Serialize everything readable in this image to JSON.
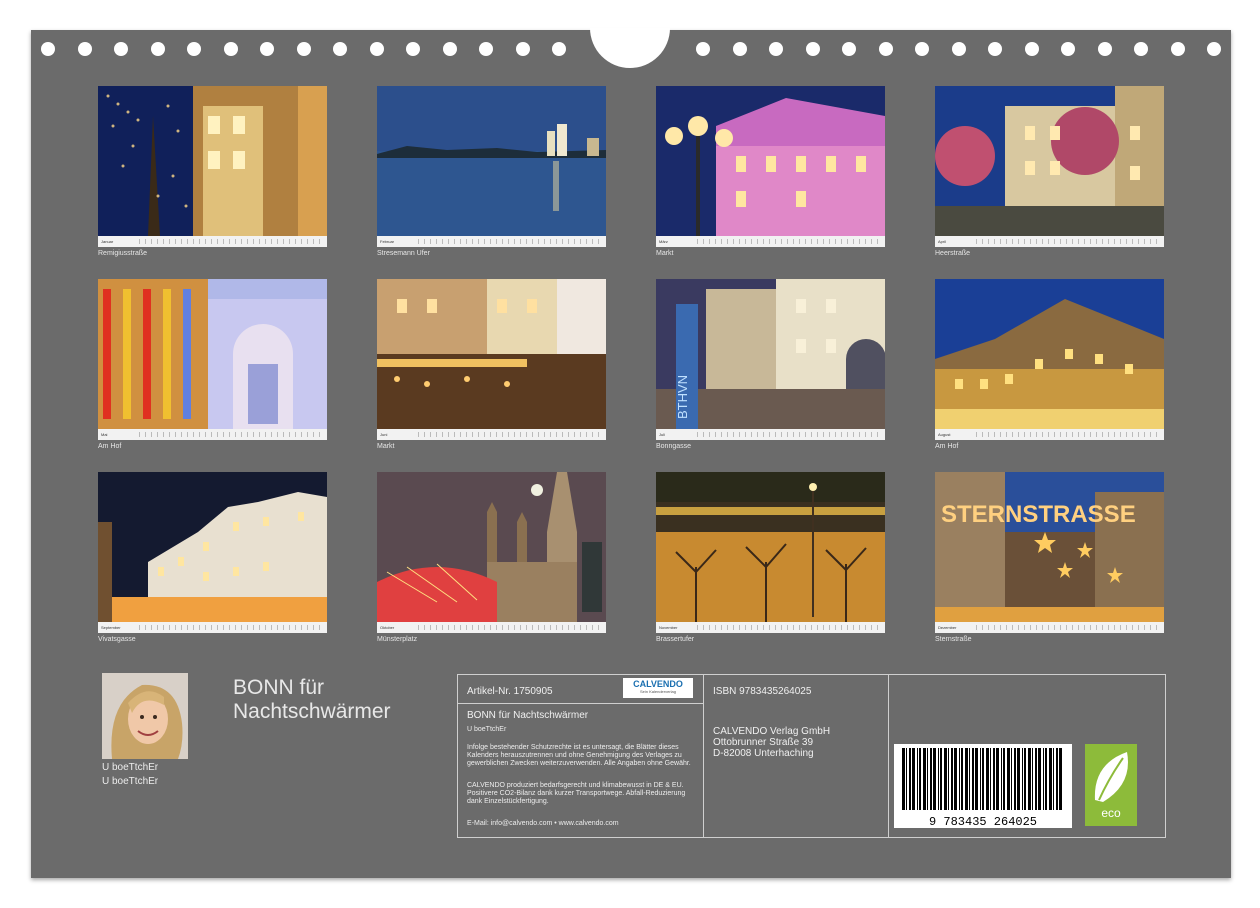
{
  "months": [
    {
      "caption": "Remigiusstraße",
      "month": "Januar"
    },
    {
      "caption": "Stresemann Ufer",
      "month": "Februar"
    },
    {
      "caption": "Markt",
      "month": "März"
    },
    {
      "caption": "Heerstraße",
      "month": "April"
    },
    {
      "caption": "Am Hof",
      "month": "Mai"
    },
    {
      "caption": "Markt",
      "month": "Juni"
    },
    {
      "caption": "Bonngasse",
      "month": "Juli"
    },
    {
      "caption": "Am Hof",
      "month": "August"
    },
    {
      "caption": "Vivatsgasse",
      "month": "September"
    },
    {
      "caption": "Münsterplatz",
      "month": "Oktober"
    },
    {
      "caption": "Brassertufer",
      "month": "November"
    },
    {
      "caption": "Sternstraße",
      "month": "Dezember"
    }
  ],
  "photo_text": {
    "sign": "STERNSTRASSE",
    "neon": "BTHVN"
  },
  "author": {
    "line1": "U boeTtchEr",
    "line2": "U boeTtchEr"
  },
  "title": {
    "line1": "BONN für",
    "line2": "Nachtschwärmer"
  },
  "info": {
    "article": "Artikel-Nr. 1750905",
    "logo": "CALVENDO",
    "logo_sub": "Sein Kalenderverlag",
    "product_title": "BONN für Nachtschwärmer",
    "product_author": "U boeTtchEr",
    "legal1": "Infolge bestehender Schutzrechte ist es untersagt, die Blätter dieses Kalenders herauszutrennen und ohne Genehmigung des Verlages zu gewerblichen Zwecken weiterzuverwenden. Alle Angaben ohne Gewähr.",
    "legal2": "CALVENDO produziert bedarfsgerecht und klimabewusst in DE & EU. Positivere CO2-Bilanz dank kurzer Transportwege. Abfall-Reduzierung dank Einzelstückfertigung.",
    "contact": "E-Mail: info@calvendo.com • www.calvendo.com",
    "isbn": "ISBN 9783435264025",
    "publisher1": "CALVENDO Verlag GmbH",
    "publisher2": "Ottobrunner Straße 39",
    "publisher3": "D-82008 Unterhaching",
    "barcode_digits": "9 783435 264025",
    "eco_label": "eco"
  },
  "colors": {
    "board": "#6b6b6b",
    "eco_green": "#8dbb3a"
  }
}
